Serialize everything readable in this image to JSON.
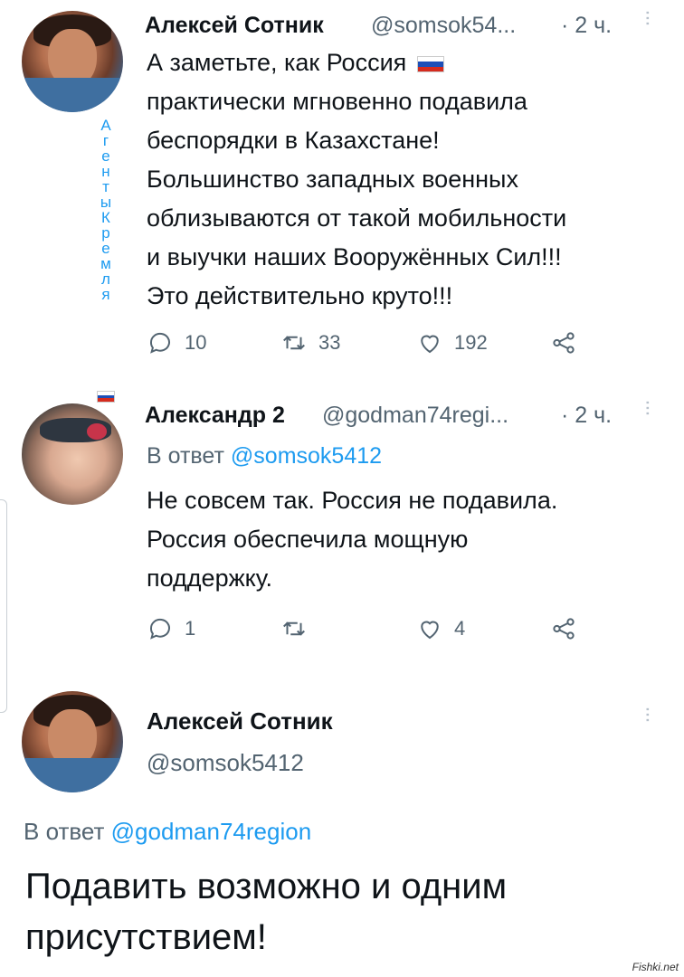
{
  "tweet1": {
    "name": "Алексей Сотник",
    "handle": "@somsok54...",
    "time": "· 2 ч.",
    "lines": [
      "А заметьте, как Россия",
      "практически мгновенно подавила",
      "беспорядки в Казахстане!",
      "Большинство западных военных",
      "облизываются от такой мобильности",
      "и выучки наших Вооружённых Сил!!!",
      "Это действительно круто!!!"
    ],
    "replies": "10",
    "retweets": "33",
    "likes": "192"
  },
  "sidebar_vertical": [
    "А",
    "г",
    "е",
    "н",
    "т",
    "ы",
    "К",
    "р",
    "е",
    "м",
    "л",
    "я"
  ],
  "tweet2": {
    "name": "Александр 2",
    "handle": "@godman74regi...",
    "time": "· 2 ч.",
    "reply_prefix": "В ответ ",
    "reply_mention": "@somsok5412",
    "lines": [
      "Не совсем так. Россия не подавила.",
      "Россия обеспечила мощную",
      "поддержку."
    ],
    "replies": "1",
    "retweets": "",
    "likes": "4"
  },
  "tweet3": {
    "name": "Алексей Сотник",
    "handle": "@somsok5412",
    "reply_prefix": "В ответ ",
    "reply_mention": "@godman74region",
    "lines": [
      "Подавить возможно и одним",
      "присутствием!"
    ]
  },
  "watermark": "Fishki.net",
  "colors": {
    "accent": "#1d9bf0",
    "muted": "#536471",
    "text": "#0f1419"
  },
  "icons": [
    "reply-icon",
    "retweet-icon",
    "like-icon",
    "share-icon",
    "more-icon",
    "flag-russia-icon"
  ]
}
